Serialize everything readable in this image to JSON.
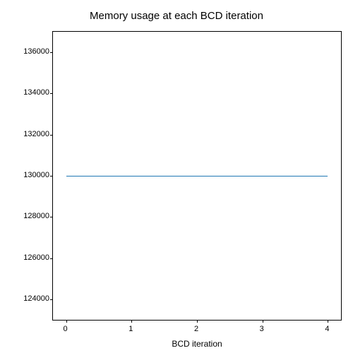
{
  "chart_data": {
    "type": "line",
    "title": "Memory usage at each BCD iteration",
    "xlabel": "BCD iteration",
    "ylabel": "",
    "x": [
      0,
      1,
      2,
      3,
      4
    ],
    "y": [
      130000,
      130000,
      130000,
      130000,
      130000
    ],
    "xlim": [
      -0.2,
      4.2
    ],
    "ylim": [
      123000,
      137000
    ],
    "xticks": [
      0,
      1,
      2,
      3,
      4
    ],
    "yticks": [
      124000,
      126000,
      128000,
      130000,
      132000,
      134000,
      136000
    ],
    "line_color": "#1f77b4"
  }
}
